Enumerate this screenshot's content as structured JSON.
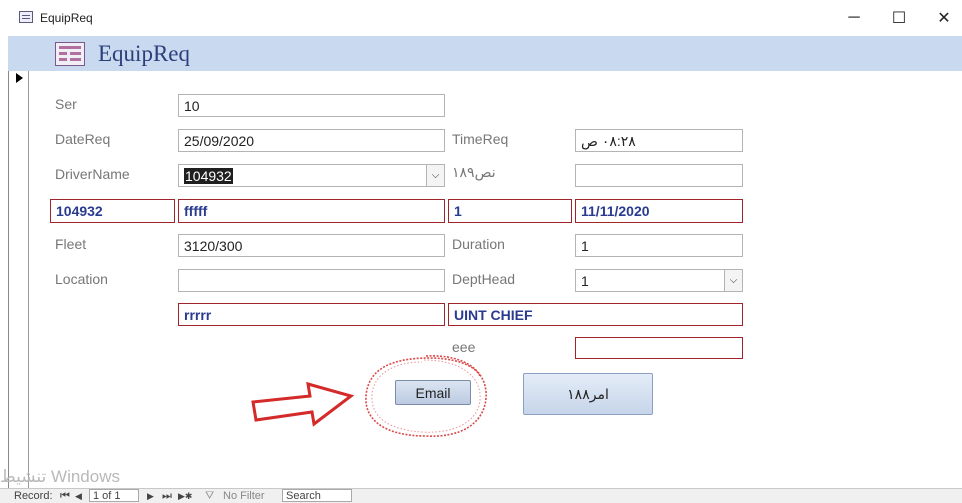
{
  "window": {
    "title": "EquipReq",
    "minimize_glyph": "─",
    "maximize_glyph": "☐",
    "close_glyph": "✕"
  },
  "form": {
    "title": "EquipReq",
    "record_selector_glyph": "▶"
  },
  "fields": {
    "ser": {
      "label": "Ser",
      "value": "10"
    },
    "datereq": {
      "label": "DateReq",
      "value": "25/09/2020"
    },
    "timereq": {
      "label": "TimeReq",
      "value": "٠٨:٢٨ ص"
    },
    "drivername": {
      "label": "DriverName",
      "value": "104932",
      "dropdown_glyph": "⌵"
    },
    "nas189": {
      "label": "نص١٨٩",
      "value": ""
    },
    "fleet": {
      "label": "Fleet",
      "value": "3120/300"
    },
    "duration": {
      "label": "Duration",
      "value": "1"
    },
    "location": {
      "label": "Location",
      "value": ""
    },
    "depthead": {
      "label": "DeptHead",
      "value": "1",
      "dropdown_glyph": "⌵"
    },
    "eee": {
      "label": "eee",
      "value": ""
    }
  },
  "computed_row": {
    "driver_id": "104932",
    "driver_name": "fffff",
    "count": "1",
    "date": "11/11/2020"
  },
  "computed_row2": {
    "location_text": "rrrrr",
    "dept_text": "UINT CHIEF"
  },
  "buttons": {
    "email_label": "Email",
    "order_label": "امر١٨٨"
  },
  "navigation": {
    "record_label": "Record:",
    "first_glyph": "⏮",
    "prev_glyph": "◀",
    "position": "1 of 1",
    "next_glyph": "▶",
    "last_glyph": "⏭",
    "new_glyph": "▶✱",
    "filter_label": "No Filter",
    "search_label": "Search"
  },
  "watermark_text": "تنشيط Windows",
  "colors": {
    "header_band": "#c9daf0",
    "title_blue": "#2b3f7a",
    "red_border": "#a0252a",
    "bound_text_blue": "#2a3b8f",
    "annotation_red": "#d42a2a"
  },
  "annotations": {
    "arrow_icon": "red-outline-arrow",
    "circle_icon": "red-hand-drawn-circle"
  }
}
